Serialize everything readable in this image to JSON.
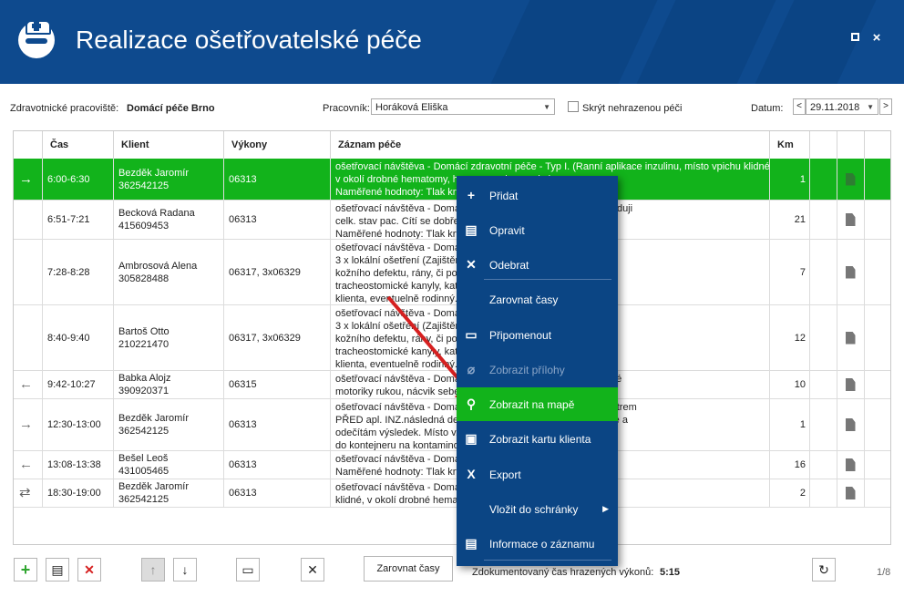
{
  "title": "Realizace ošetřovatelské péče",
  "window": {
    "restore_icon": "square",
    "close_icon": "×"
  },
  "filters": {
    "workplace_label": "Zdravotnické pracoviště:",
    "workplace_value": "Domácí péče Brno",
    "worker_label": "Pracovník:",
    "worker_value": "Horáková Eliška",
    "hide_label": "Skrýt nehrazenou péči",
    "date_label": "Datum:",
    "date_value": "29.11.2018",
    "prev": "<",
    "next": ">"
  },
  "columns": {
    "cas": "Čas",
    "klient": "Klient",
    "vykony": "Výkony",
    "zaznam": "Záznam péče",
    "km": "Km"
  },
  "rows": [
    {
      "dir": "→",
      "time": "6:00-6:30",
      "client": "Bezděk Jaromír",
      "client_id": "362542125",
      "vykony": "06313",
      "zaznam": [
        "ošetřovací návštěva - Domácí zdravotní péče - Typ I. (Ranní aplikace inzulinu, místo vpichu klidné,",
        "v okolí drobné hematomy, h...                                            ...e, spolupracuje.)",
        "Naměřené hodnoty: Tlak krv..."
      ],
      "km": "1",
      "selected": true
    },
    {
      "dir": "",
      "time": "6:51-7:21",
      "client": "Becková Radana",
      "client_id": "415609453",
      "vykony": "06313",
      "zaznam": [
        "ošetřovací návštěva - Domá...                                        ...toring pac.: změřen TK, P a sleduji",
        "celk. stav pac. Cítí se dobře...",
        "Naměřené hodnoty: Tlak krv..."
      ],
      "km": "21",
      "selected": false
    },
    {
      "dir": "",
      "time": "7:28-8:28",
      "client": "Ambrosová Alena",
      "client_id": "305828488",
      "vykony": "06317, 3x06329",
      "zaznam": [
        "ošetřovací návštěva - Domá...",
        "3 x lokální ošetření (Zajištěn...                                    ...dinovaného lokálního ošetření",
        "kožního defektu, rány, či po...                                       ...čkosti tracheální kanyly,",
        "tracheostomické kanyly, kat...                                         ...centrálního katetru . Edukace",
        "klienta, eventuelně rodinný..."
      ],
      "km": "7",
      "selected": false
    },
    {
      "dir": "",
      "time": "8:40-9:40",
      "client": "Bartoš Otto",
      "client_id": "210221470",
      "vykony": "06317, 3x06329",
      "zaznam": [
        "ošetřovací návštěva - Domá...",
        "3 x lokální ošetření (Zajištěn...                                    ...dinovaného lokálního ošetření",
        "kožního defektu, rány, či po...                                       ...čkosti tracheální kanyly,",
        "tracheostomické kanyly, kat...                                         ...centrálního katetru . Edukace",
        "klienta, eventuelně rodinný..."
      ],
      "km": "12",
      "selected": false
    },
    {
      "dir": "←",
      "time": "9:42-10:27",
      "client": "Babka Alojz",
      "client_id": "390920371",
      "vykony": "06315",
      "zaznam": [
        "ošetřovací návštěva - Doma...                                         ...stupů na zlepšení hrubé i jemné",
        "motoriky rukou, nácvik sebe..."
      ],
      "km": "10",
      "selected": false
    },
    {
      "dir": "→",
      "time": "12:30-13:00",
      "client": "Bezděk Jaromír",
      "client_id": "362542125",
      "vykony": "06313",
      "zaznam": [
        "ošetřovací návštěva - Doma...                                         ...oslední glykemie pac. glukometrem",
        "PŘED apl. INZ.následná dez...                                          ...říška 4. prstu L ruky, komprese a",
        "odečítám výsledek. Místo v...                                          ...jednorázový materiál odkládám",
        "do kontejneru na kontamino..."
      ],
      "km": "1",
      "selected": false
    },
    {
      "dir": "←",
      "time": "13:08-13:38",
      "client": "Bešel Leoš",
      "client_id": "431005465",
      "vykony": "06313",
      "zaznam": [
        "ošetřovací návštěva - Doma...                                         ...toring pac.: změřen TK)",
        "Naměřené hodnoty: Tlak krv..."
      ],
      "km": "16",
      "selected": false
    },
    {
      "dir": "⇄",
      "time": "18:30-19:00",
      "client": "Bezděk Jaromír",
      "client_id": "362542125",
      "vykony": "06313",
      "zaznam": [
        "ošetřovací návštěva - Doma...                                         ...plikace inzulinu, místo vpichu",
        "klidné, v okolí drobné hemat..."
      ],
      "km": "2",
      "selected": false
    }
  ],
  "context_menu": [
    {
      "label": "Přidat",
      "icon": "plus-icon",
      "glyph": "+"
    },
    {
      "label": "Opravit",
      "icon": "edit-icon",
      "glyph": "▤"
    },
    {
      "label": "Odebrat",
      "icon": "delete-icon",
      "glyph": "✕"
    },
    {
      "label": "Zarovnat časy",
      "icon": "",
      "glyph": ""
    },
    {
      "label": "Připomenout",
      "icon": "remind-icon",
      "glyph": "▭"
    },
    {
      "label": "Zobrazit přílohy",
      "icon": "paperclip-icon",
      "glyph": "⌀",
      "disabled": true
    },
    {
      "label": "Zobrazit na mapě",
      "icon": "map-pin-icon",
      "glyph": "⚲",
      "highlighted": true
    },
    {
      "label": "Zobrazit kartu klienta",
      "icon": "client-card-icon",
      "glyph": "▣"
    },
    {
      "label": "Export",
      "icon": "excel-icon",
      "glyph": "X"
    },
    {
      "label": "Vložit do schránky",
      "icon": "",
      "glyph": "",
      "submenu": "▶"
    },
    {
      "label": "Informace o záznamu",
      "icon": "info-icon",
      "glyph": "▤"
    }
  ],
  "bottom": {
    "align_button": "Zarovnat časy",
    "doc_time_label": "Zdokumentovaný čas hrazených výkonů:",
    "doc_time_value": "5:15",
    "page": "1/8"
  },
  "colors": {
    "brand": "#0e4a8e",
    "selected_row": "#12b31b",
    "menu_bg": "#0b4584",
    "menu_highlight": "#12b31b",
    "arrow": "#d62020"
  }
}
